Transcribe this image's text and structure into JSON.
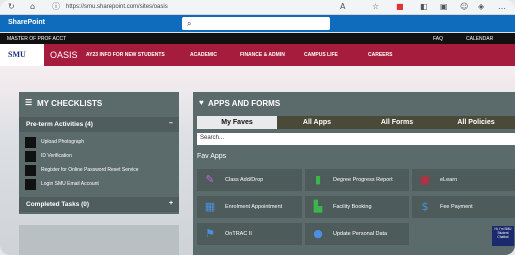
{
  "browser": {
    "url": "https://smu.sharepoint.com/sites/oasis",
    "icons": [
      "refresh-icon",
      "home-icon",
      "info-icon",
      "read-aloud-icon",
      "favorite-icon",
      "extension-icon",
      "split-icon",
      "collections-icon",
      "profile-icon",
      "copilot-icon"
    ]
  },
  "sharepoint": {
    "title": "SharePoint",
    "search_icon": "⌕"
  },
  "topbar": {
    "left": "MASTER OF PROF ACCT",
    "faq": "FAQ",
    "calendar": "CALENDAR"
  },
  "nav": {
    "logo": "SMU",
    "title": "OASIS",
    "items": [
      {
        "label": "AY23 INFO FOR NEW STUDENTS"
      },
      {
        "label": "ACADEMIC"
      },
      {
        "label": "FINANCE & ADMIN"
      },
      {
        "label": "CAMPUS LIFE"
      },
      {
        "label": "CAREERS"
      }
    ]
  },
  "checklists": {
    "title": "MY CHECKLISTS",
    "preterm": {
      "label": "Pre-term Activities (4)",
      "toggle": "–"
    },
    "tasks": [
      "Upload Photograph",
      "ID Verification",
      "Register for Online Password Reset Service",
      "Login SMU Email Account"
    ],
    "completed": {
      "label": "Completed Tasks (0)",
      "toggle": "+"
    }
  },
  "apps": {
    "title": "APPS AND FORMS",
    "tabs": [
      "My Faves",
      "All Apps",
      "All Forms",
      "All Policies"
    ],
    "active_tab": "My Faves",
    "search_placeholder": "Search...",
    "fav_label": "Fav Apps",
    "tiles": [
      {
        "label": "Class Add/Drop",
        "icon": "edit-icon",
        "color": "#b76ad6"
      },
      {
        "label": "Degree Progress Report",
        "icon": "chart-icon",
        "color": "#3cb54a"
      },
      {
        "label": "eLearn",
        "icon": "elearn-icon",
        "color": "#d0243c"
      },
      {
        "label": "Enrolment Appointment",
        "icon": "calendar-icon",
        "color": "#4a8fe0"
      },
      {
        "label": "Facility Booking",
        "icon": "booking-icon",
        "color": "#3cb54a"
      },
      {
        "label": "Fee Payment",
        "icon": "dollar-icon",
        "color": "#4a8fe0"
      },
      {
        "label": "OnTRAC II",
        "icon": "runner-icon",
        "color": "#4a8fe0"
      },
      {
        "label": "Update Personal Data",
        "icon": "person-icon",
        "color": "#4a8fe0"
      }
    ]
  },
  "badge": {
    "text": "Hi, I'm SMU Student Chatbot"
  }
}
